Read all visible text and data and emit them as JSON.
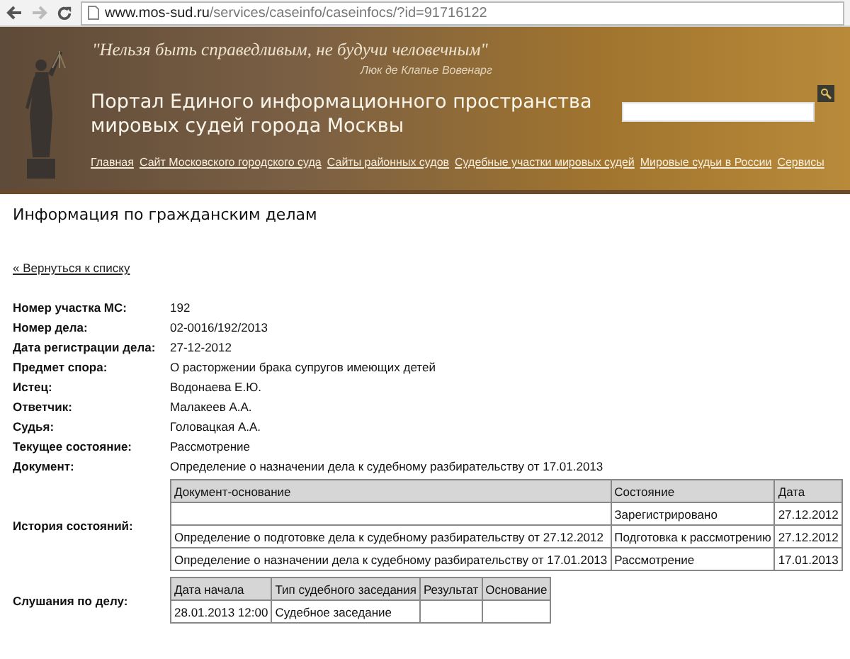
{
  "browser": {
    "url_host": "www.mos-sud.ru",
    "url_path": "/services/caseinfo/caseinfocs/?id=91716122"
  },
  "header": {
    "quote": "\"Нельзя быть справедливым, не будучи человечным\"",
    "quote_author": "Люк де Клапье Вовенарг",
    "portal_title": [
      "Портал Единого информационного пространства",
      "мировых судей города Москвы"
    ],
    "nav": [
      "Главная",
      "Сайт Московского городского суда",
      "Сайты районных судов",
      "Судебные участки мировых судей",
      "Мировые судьи в России",
      "Сервисы"
    ]
  },
  "page_title": "Информация по гражданским делам",
  "back_link": "« Вернуться к списку",
  "fields": [
    {
      "label": "Номер участка МС:",
      "value": "192"
    },
    {
      "label": "Номер дела:",
      "value": "02-0016/192/2013"
    },
    {
      "label": "Дата регистрации дела:",
      "value": "27-12-2012"
    },
    {
      "label": "Предмет спора:",
      "value": "О расторжении брака супругов имеющих детей"
    },
    {
      "label": "Истец:",
      "value": "Водонаева Е.Ю."
    },
    {
      "label": "Ответчик:",
      "value": "Малакеев А.А."
    },
    {
      "label": "Судья:",
      "value": "Головацкая А.А."
    },
    {
      "label": "Текущее состояние:",
      "value": "Рассмотрение"
    },
    {
      "label": "Документ:",
      "value": "Определение о назначении дела к судебному разбирательству от 17.01.2013"
    }
  ],
  "history": {
    "label": "История состояний:",
    "columns": [
      "Документ-основание",
      "Состояние",
      "Дата"
    ],
    "rows": [
      [
        "",
        "Зарегистрировано",
        "27.12.2012"
      ],
      [
        "Определение о подготовке дела к судебному разбирательству от 27.12.2012",
        "Подготовка к рассмотрению",
        "27.12.2012"
      ],
      [
        "Определение о назначении дела к судебному разбирательству от 17.01.2013",
        "Рассмотрение",
        "17.01.2013"
      ]
    ]
  },
  "hearings": {
    "label": "Слушания по делу:",
    "columns": [
      "Дата начала",
      "Тип судебного заседания",
      "Результат",
      "Основание"
    ],
    "rows": [
      [
        "28.01.2013 12:00",
        "Судебное заседание",
        "",
        ""
      ]
    ]
  }
}
